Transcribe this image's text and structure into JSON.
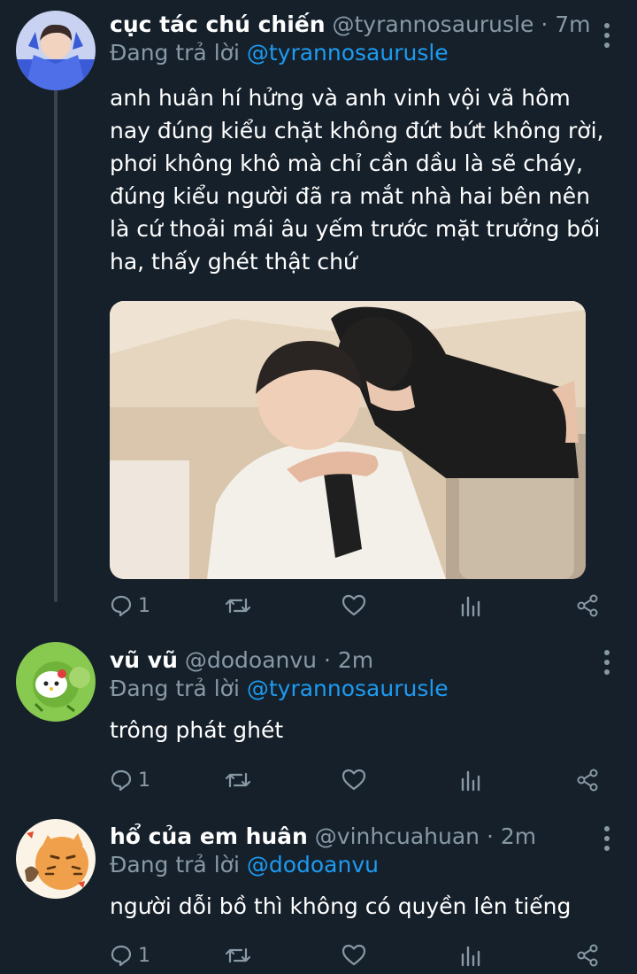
{
  "tweets": [
    {
      "name": "cục tác chú chiến",
      "handle": "@tyrannosaurusle",
      "separator": "·",
      "time": "7m",
      "reply_label": "Đang trả lời",
      "reply_to": "@tyrannosaurusle",
      "text": "anh huân hí hửng và anh vinh vội vã hôm nay đúng kiểu chặt không đứt bứt không rời, phơi không khô mà chỉ cần dầu là sẽ cháy, đúng kiểu người đã ra mắt nhà hai bên nên là cứ thoải mái âu yếm trước mặt trưởng bối ha, thấy ghét thật chứ",
      "reply_count": "1"
    },
    {
      "name": "vũ vũ",
      "handle": "@dodoanvu",
      "separator": "·",
      "time": "2m",
      "reply_label": "Đang trả lời",
      "reply_to": "@tyrannosaurusle",
      "text": "trông phát ghét",
      "reply_count": "1"
    },
    {
      "name": "hổ của em huân",
      "handle": "@vinhcuahuan",
      "separator": "·",
      "time": "2m",
      "reply_label": "Đang trả lời",
      "reply_to": "@dodoanvu",
      "text": "người dỗi bồ thì không có quyền lên tiếng",
      "reply_count": "1"
    }
  ],
  "icons": {
    "reply": "reply-icon",
    "retweet": "retweet-icon",
    "like": "heart-icon",
    "analytics": "analytics-icon",
    "share": "share-icon",
    "more": "more-vertical-icon"
  },
  "colors": {
    "background": "#15202b",
    "accent": "#1d9bf0",
    "secondary_text": "#8899a6",
    "thread_line": "#3a4450"
  }
}
